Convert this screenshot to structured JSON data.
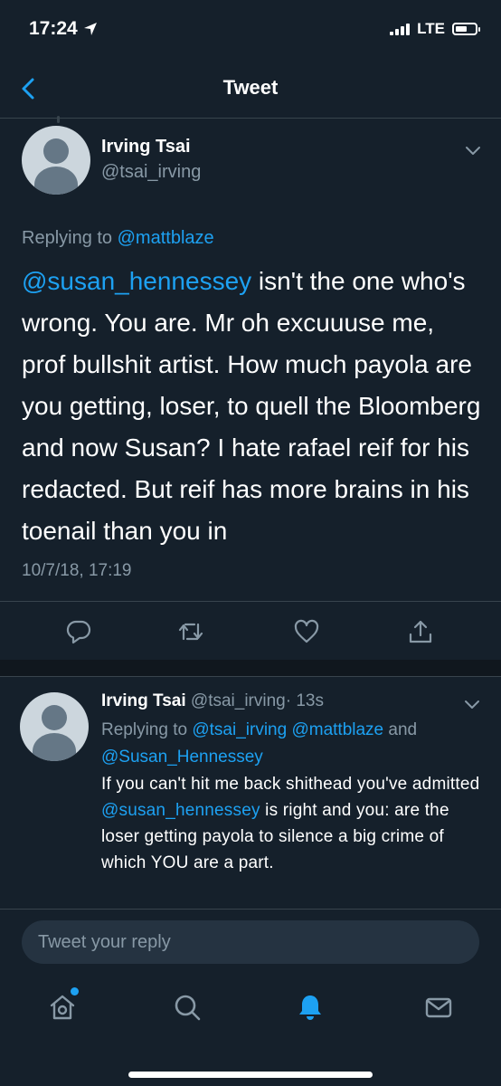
{
  "status_bar": {
    "time": "17:24",
    "network": "LTE",
    "battery_level": 0.6
  },
  "nav": {
    "title": "Tweet"
  },
  "tweet": {
    "author_name": "Irving Tsai",
    "author_handle": "@tsai_irving",
    "replying_prefix": "Replying to",
    "replying_to": "@mattblaze",
    "mention": "@susan_hennessey",
    "text": " isn't the one who's wrong. You are. Mr oh excuuuse me, prof bullshit artist. How much payola are you getting, loser, to quell the Bloomberg and now Susan? I hate rafael reif for his redacted. But reif has more brains in his toenail than you in",
    "timestamp": "10/7/18, 17:19"
  },
  "reply": {
    "author_name": "Irving Tsai",
    "author_handle": "@tsai_irving",
    "time_ago": "· 13s",
    "replying_prefix": "Replying to",
    "replying_to_1": "@tsai_irving",
    "replying_to_2": "@mattblaze",
    "replying_and": "and",
    "replying_to_3": "@Susan_Hennessey",
    "text_1": "If you can't hit me back shithead you've admitted ",
    "mention": "@susan_hennessey",
    "text_2": " is right and you: are the loser getting payola to silence a big crime of which YOU are a part."
  },
  "compose": {
    "placeholder": "Tweet your reply"
  },
  "tabs": [
    "home-icon",
    "search-icon",
    "notifications-icon",
    "messages-icon"
  ],
  "colors": {
    "background": "#15202b",
    "accent": "#1da1f2",
    "secondary_text": "#8899a6",
    "border": "#38444d"
  }
}
